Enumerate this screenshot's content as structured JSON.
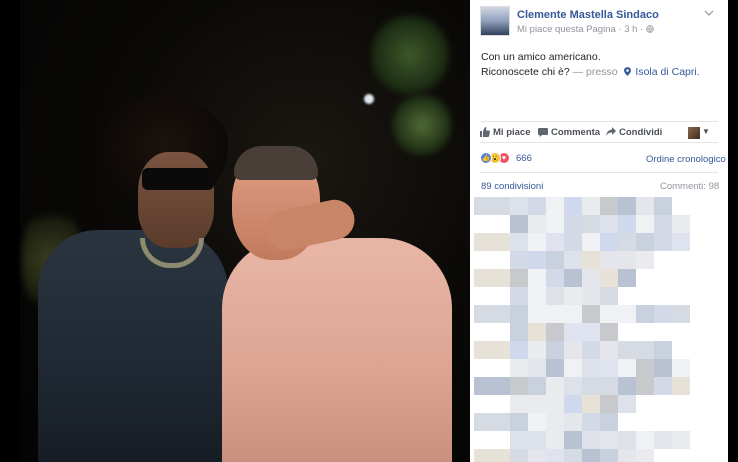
{
  "post": {
    "page_name": "Clemente Mastella Sindaco",
    "like_page": "Mi piace questa Pagina",
    "time": "3 h",
    "text_line1": "Con un amico americano.",
    "text_line2": "Riconoscete chi è?",
    "presso": "— presso",
    "location": "Isola di Capri."
  },
  "actions": {
    "like": "Mi piace",
    "comment": "Commenta",
    "share": "Condividi"
  },
  "reactions": {
    "count": "666",
    "order_label": "Ordine cronologico"
  },
  "stats": {
    "shares": "89 condivisioni",
    "comments": "Commenti: 98"
  },
  "colors": {
    "link": "#365899",
    "muted": "#90949c",
    "text": "#1d2129",
    "like_blue": "#4f7df0",
    "wow_yellow": "#f7c540",
    "love_red": "#f25268"
  },
  "icons": {
    "like": "thumbs-up-icon",
    "comment": "speech-bubble-icon",
    "share": "share-arrow-icon",
    "location": "map-pin-icon",
    "globe": "globe-icon",
    "menu": "chevron-down-icon"
  }
}
